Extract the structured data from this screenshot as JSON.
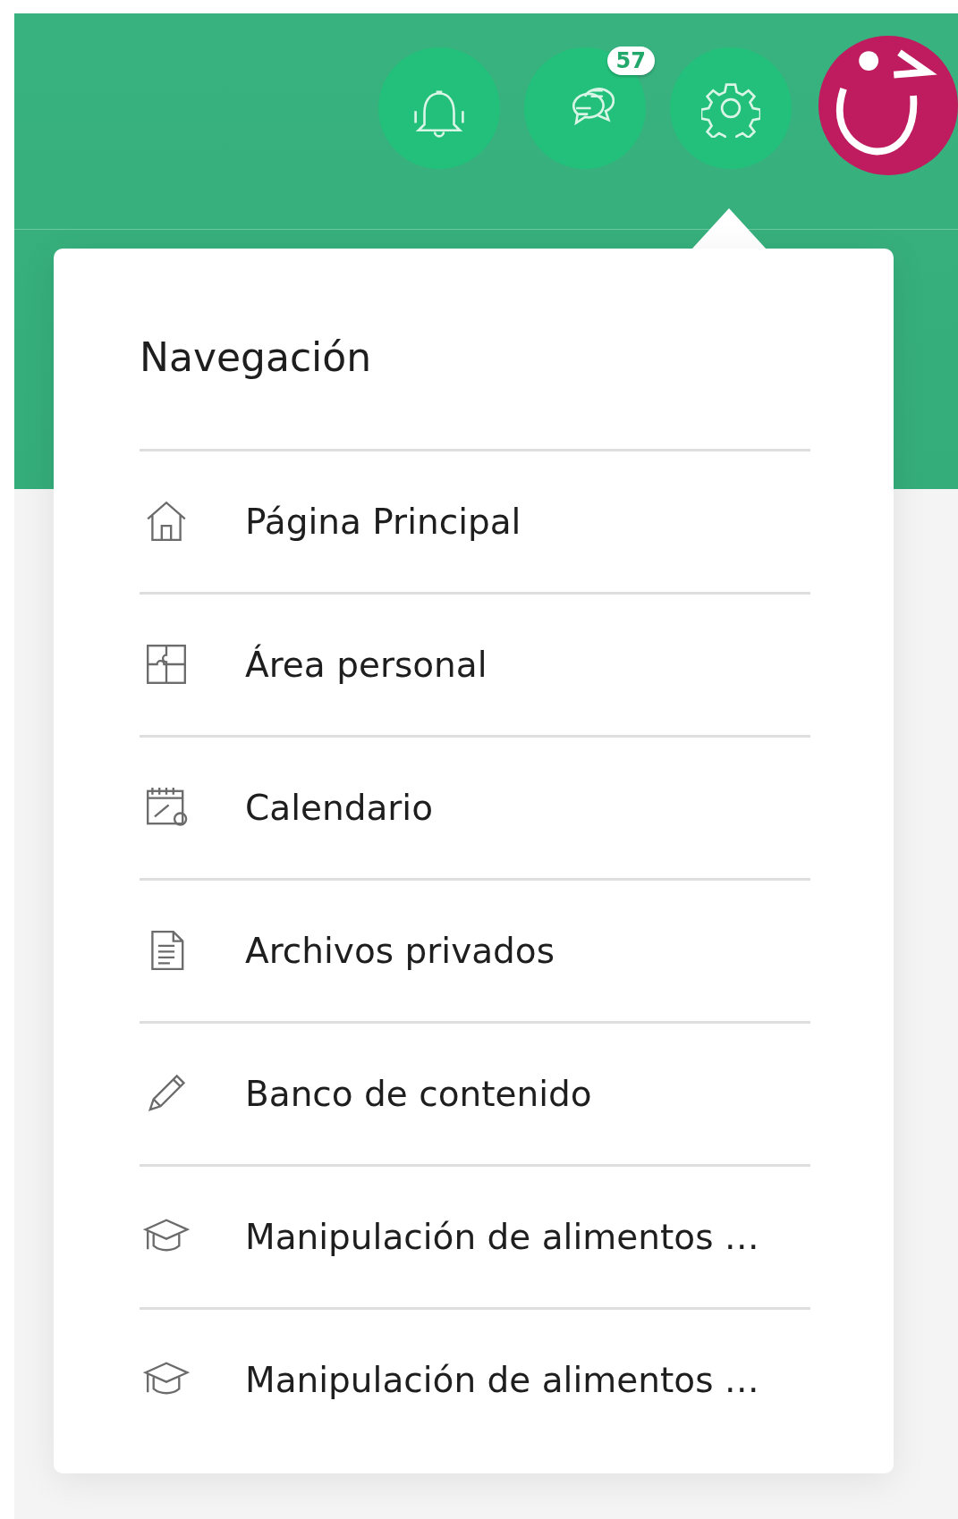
{
  "header": {
    "buttons": [
      {
        "kind": "bell",
        "selected": false
      },
      {
        "kind": "chat",
        "badge": "57",
        "selected": false
      },
      {
        "kind": "gear",
        "selected": true
      }
    ]
  },
  "menu": {
    "title": "Navegación",
    "items": [
      {
        "kind": "home",
        "label": "Página Principal"
      },
      {
        "kind": "puzzle",
        "label": "Área personal"
      },
      {
        "kind": "calendar",
        "label": "Calendario"
      },
      {
        "kind": "document",
        "label": "Archivos privados"
      },
      {
        "kind": "pencil",
        "label": "Banco de contenido"
      },
      {
        "kind": "cap",
        "label": "Manipulación de alimentos …"
      },
      {
        "kind": "cap",
        "label": "Manipulación de alimentos …"
      }
    ]
  }
}
